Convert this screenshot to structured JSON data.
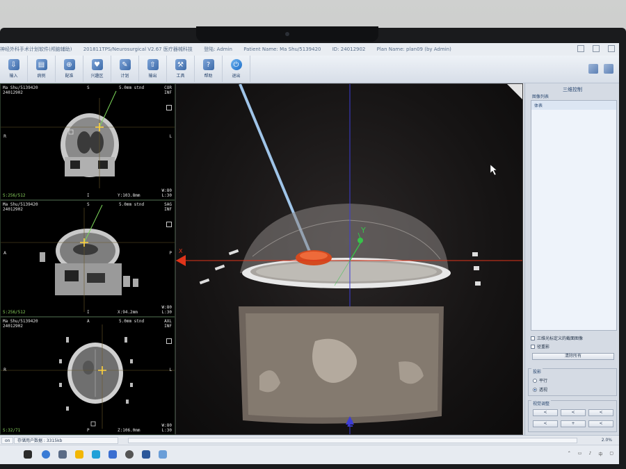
{
  "window": {
    "title_prefix": "神经外科手术计划软件(颅脑辅助)",
    "title_version": "201811TPS/Neurosurgical V2.67 医疗器械科技",
    "login": "登陆: Admin",
    "patient": "Patient Name: Ma Shu/5139420",
    "id": "ID: 24012902",
    "plan": "Plan Name: plan09 (by Admin)"
  },
  "toolbar": [
    {
      "label": "输入",
      "icon": "import-icon",
      "glyph": "⇩"
    },
    {
      "label": "病例",
      "icon": "case-icon",
      "glyph": "▤"
    },
    {
      "label": "配准",
      "icon": "register-icon",
      "glyph": "⊕"
    },
    {
      "label": "兴趣区",
      "icon": "roi-icon",
      "glyph": "♥"
    },
    {
      "label": "计划",
      "icon": "plan-icon",
      "glyph": "✎"
    },
    {
      "label": "输出",
      "icon": "export-icon",
      "glyph": "⇧"
    },
    {
      "label": "工具",
      "icon": "tools-icon",
      "glyph": "⚒"
    },
    {
      "label": "帮助",
      "icon": "help-icon",
      "glyph": "?"
    },
    {
      "label": "退出",
      "icon": "power-icon",
      "glyph": "⏻"
    }
  ],
  "slices": [
    {
      "patient": "Ma Shu/5139420",
      "id": "24012902",
      "top_center": "S",
      "thickness": "5.0mm stnd",
      "view": "COR",
      "mode": "INF",
      "left": "R",
      "right": "L",
      "index": "S:256/512",
      "bottom_center": "I",
      "coord": "Y:103.8mm",
      "wl": "W:80",
      "ll": "L:30"
    },
    {
      "patient": "Ma Shu/5139420",
      "id": "24012902",
      "top_center": "S",
      "thickness": "5.0mm stnd",
      "view": "SAG",
      "mode": "INF",
      "left": "A",
      "right": "P",
      "index": "S:256/512",
      "bottom_center": "I",
      "coord": "X:94.2mm",
      "wl": "W:80",
      "ll": "L:30"
    },
    {
      "patient": "Ma Shu/5139420",
      "id": "24012902",
      "top_center": "A",
      "thickness": "5.0mm stnd",
      "view": "AXL",
      "mode": "INF",
      "left": "R",
      "right": "L",
      "index": "S:32/71",
      "bottom_center": "P",
      "coord": "Z:106.0mm",
      "wl": "W:80",
      "ll": "L:30"
    }
  ],
  "view3d": {
    "axis_y": "Y",
    "axis_z": "Z",
    "axis_x": "X"
  },
  "panel": {
    "title": "三维控制",
    "list_label": "图像列表",
    "list_items": [
      "体表"
    ],
    "check1": "三维光标定义的截面图像",
    "check2": "径重影",
    "clear_btn": "清除所有",
    "projection_label": "投影",
    "radio1": "平行",
    "radio2": "透视",
    "view_dir_label": "视觉调整",
    "view_buttons": [
      "<",
      "<",
      "<",
      "<",
      "+",
      "<"
    ]
  },
  "status": {
    "left": "on",
    "data_label": "存储用户数据 : 3315kb",
    "right": "2.0%"
  }
}
